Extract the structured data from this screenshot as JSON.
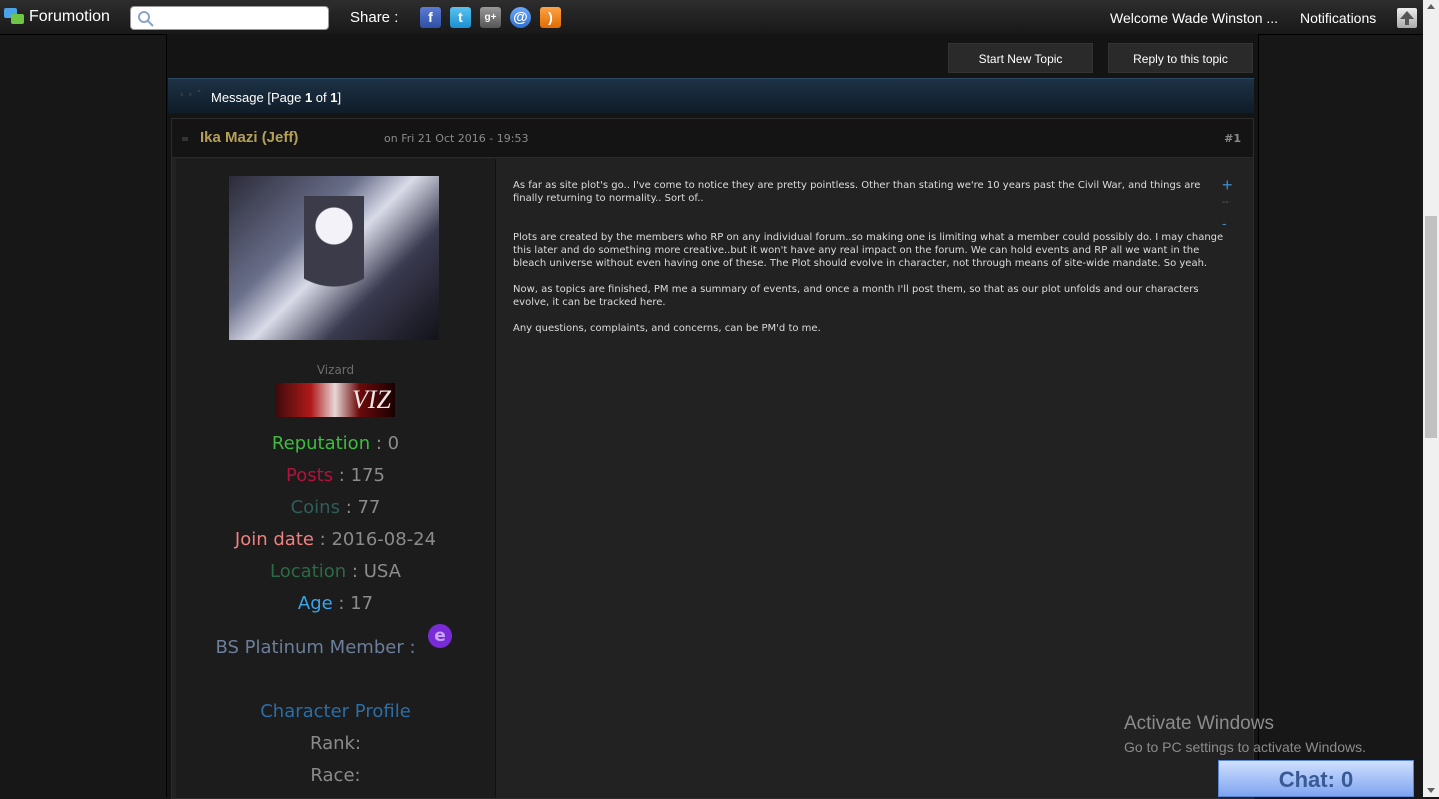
{
  "topbar": {
    "site_name": "Forumotion",
    "search_placeholder": "",
    "share_label": "Share :",
    "share_icons": [
      "facebook-icon",
      "twitter-icon",
      "google-plus-icon",
      "email-icon",
      "rss-icon"
    ],
    "welcome": "Welcome Wade Winston ...",
    "notifications": "Notifications"
  },
  "actions": {
    "new_topic": "Start New Topic",
    "reply": "Reply to this topic"
  },
  "message_bar": {
    "prefix": "Message [Page ",
    "page": "1",
    "of": " of ",
    "total": "1",
    "suffix": "]"
  },
  "post": {
    "author": "Ika Mazi (Jeff)",
    "date": "on Fri 21 Oct 2016 - 19:53",
    "number": "#1",
    "body": [
      "As far as site plot's go.. I've come to notice they are pretty pointless. Other than stating we're 10 years past the Civil War, and things are finally returning to normality.. Sort of..",
      "Plots are created by the members who RP on any individual forum..so making one is limiting what a member could possibly do. I may change this later and do something more creative..but it won't have any real impact on the forum. We can hold events and RP all we want in the bleach universe without even having one of these. The Plot should evolve in character, not through means of site-wide mandate. So yeah.",
      "Now, as topics are finished, PM me a summary of events, and once a month I'll post them, so that as our plot unfolds and our characters evolve, it can be tracked here.",
      "Any questions, complaints, and concerns, can be PM'd to me."
    ],
    "vote": {
      "plus": "+",
      "score": "--",
      "minus": "-"
    }
  },
  "profile": {
    "rank_title": "Vizard",
    "rank_image_text": "VIZ",
    "fields": {
      "reputation": {
        "label": "Reputation",
        "sep": " : ",
        "value": "0"
      },
      "posts": {
        "label": "Posts",
        "sep": " : ",
        "value": "175"
      },
      "coins": {
        "label": "Coins",
        "sep": " : ",
        "value": "77"
      },
      "join_date": {
        "label": "Join date",
        "sep": " : ",
        "value": "2016-08-24"
      },
      "location": {
        "label": "Location",
        "sep": " : ",
        "value": "USA"
      },
      "age": {
        "label": "Age",
        "sep": " : ",
        "value": "17"
      }
    },
    "bs_member": "BS Platinum Member :",
    "bs_icon": "e",
    "character_profile": "Character Profile",
    "rank": "Rank:",
    "race": "Race:"
  },
  "os_overlay": {
    "activate_title": "Activate Windows",
    "activate_sub": "Go to PC settings to activate Windows."
  },
  "chat": {
    "label": "Chat: 0"
  }
}
